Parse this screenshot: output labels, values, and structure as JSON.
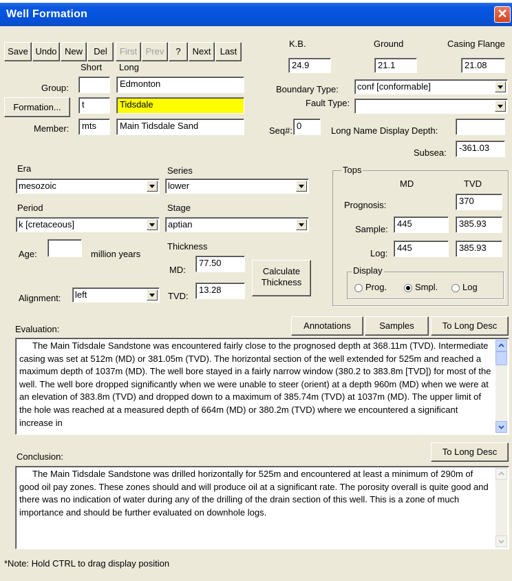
{
  "window": {
    "title": "Well Formation",
    "close_glyph": "✕"
  },
  "toolbar": {
    "save": "Save",
    "undo": "Undo",
    "new": "New",
    "del": "Del",
    "first": "First",
    "prev": "Prev",
    "help": "?",
    "next": "Next",
    "last": "Last"
  },
  "elevations": {
    "kb_label": "K.B.",
    "kb_value": "24.9",
    "ground_label": "Ground",
    "ground_value": "21.1",
    "casing_label": "Casing Flange",
    "casing_value": "21.08"
  },
  "names": {
    "short_header": "Short",
    "long_header": "Long",
    "group_label": "Group:",
    "group_short": "",
    "group_long": "Edmonton",
    "formation_button": "Formation...",
    "formation_short": "t",
    "formation_long": "Tidsdale",
    "member_label": "Member:",
    "member_short": "mts",
    "member_long": "Main Tidsdale Sand"
  },
  "boundary": {
    "label": "Boundary Type:",
    "value": "conf  [conformable]"
  },
  "fault": {
    "label": "Fault Type:",
    "value": ""
  },
  "seq": {
    "label": "Seq#:",
    "value": "0"
  },
  "long_name_depth": {
    "label": "Long Name Display Depth:",
    "value": ""
  },
  "subsea": {
    "label": "Subsea:",
    "value": "-361.03"
  },
  "era": {
    "label": "Era",
    "value": "mesozoic"
  },
  "series": {
    "label": "Series",
    "value": "lower"
  },
  "period": {
    "label": "Period",
    "value": "k  [cretaceous]"
  },
  "stage": {
    "label": "Stage",
    "value": "aptian"
  },
  "age": {
    "label": "Age:",
    "value": "",
    "unit": "million years"
  },
  "thickness": {
    "label": "Thickness",
    "md_label": "MD:",
    "md_value": "77.50",
    "tvd_label": "TVD:",
    "tvd_value": "13.28",
    "calc_line1": "Calculate",
    "calc_line2": "Thickness"
  },
  "alignment": {
    "label": "Alignment:",
    "value": "left"
  },
  "tops": {
    "title": "Tops",
    "md_header": "MD",
    "tvd_header": "TVD",
    "prognosis_label": "Prognosis:",
    "prognosis_md": "",
    "prognosis_tvd": "370",
    "sample_label": "Sample:",
    "sample_md": "445",
    "sample_tvd": "385.93",
    "log_label": "Log:",
    "log_md": "445",
    "log_tvd": "385.93",
    "display_title": "Display",
    "display_options": [
      "Prog.",
      "Smpl.",
      "Log"
    ],
    "display_selected": "Smpl."
  },
  "evaluation": {
    "label": "Evaluation:",
    "annotations_button": "Annotations",
    "samples_button": "Samples",
    "to_long_desc_button": "To Long Desc",
    "text": "The Main Tidsdale Sandstone was encountered fairly close to the prognosed depth at 368.11m (TVD). Intermediate casing was set at 512m (MD) or 381.05m (TVD). The horizontal section of the well extended for 525m and reached a maximum depth of 1037m (MD). The well bore stayed in a fairly narrow window (380.2 to 383.8m [TVD]) for most of the well. The well bore dropped significantly when we were unable to steer (orient) at a depth 960m (MD) when we were at an elevation of 383.8m (TVD) and dropped down to a maximum of 385.74m (TVD) at 1037m (MD). The upper limit of the hole was reached at a measured depth of 664m (MD) or 380.2m (TVD) where we encountered a significant increase in"
  },
  "conclusion": {
    "label": "Conclusion:",
    "to_long_desc_button": "To Long Desc",
    "text": "The Main Tidsdale Sandstone was drilled horizontally for 525m and encountered at least a minimum of 290m of good oil pay zones. These zones should and will produce oil at a significant rate. The porosity overall is quite good and there was no indication of water during any of the drilling of the drain section of this well. This is a zone of much importance and should be further evaluated on downhole logs."
  },
  "note": "*Note: Hold CTRL to drag display position"
}
